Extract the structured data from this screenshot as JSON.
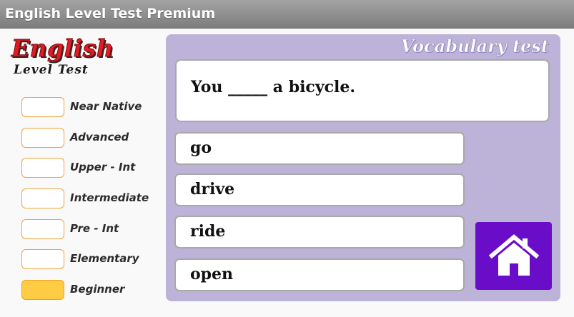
{
  "window": {
    "title": "English Level Test Premium"
  },
  "logo": {
    "title": "English",
    "subtitle": "Level Test"
  },
  "levels": [
    {
      "label": "Near Native",
      "active": false
    },
    {
      "label": "Advanced",
      "active": false
    },
    {
      "label": "Upper - Int",
      "active": false
    },
    {
      "label": "Intermediate",
      "active": false
    },
    {
      "label": "Pre - Int",
      "active": false
    },
    {
      "label": "Elementary",
      "active": false
    },
    {
      "label": "Beginner",
      "active": true
    }
  ],
  "test": {
    "title": "Vocabulary test",
    "question": "You _____ a bicycle.",
    "answers": [
      "go",
      "drive",
      "ride",
      "open"
    ]
  },
  "home_button": {
    "icon": "home-icon"
  },
  "colors": {
    "panel": "#bdb3d9",
    "home_button": "#6a0dc8",
    "logo_red": "#e41b22",
    "level_active": "#ffcc44",
    "level_border": "#f3a33a"
  }
}
